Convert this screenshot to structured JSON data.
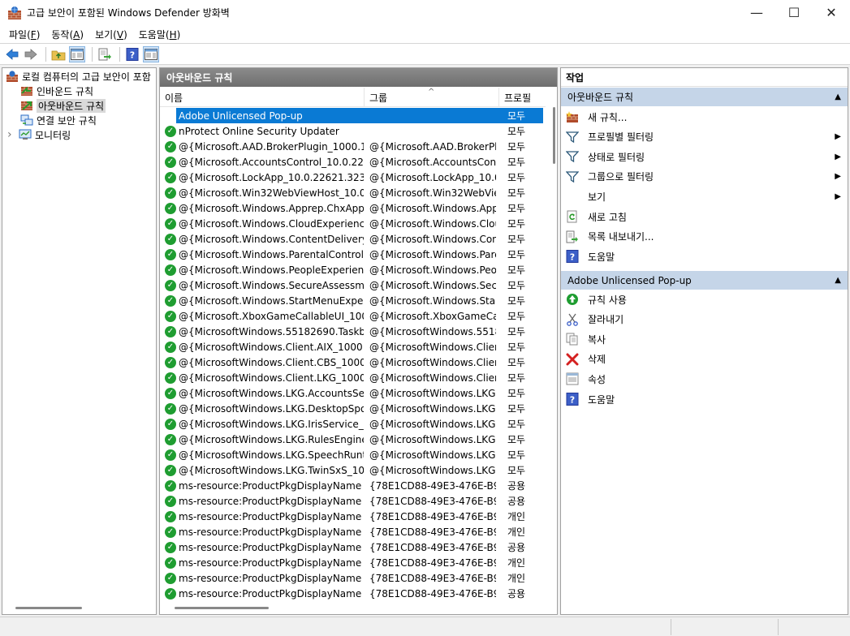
{
  "window": {
    "title": "고급 보안이 포함된 Windows Defender 방화벽",
    "minimize": "—",
    "maximize": "☐",
    "close": "✕"
  },
  "menu": [
    {
      "label": "파일",
      "key": "F"
    },
    {
      "label": "동작",
      "key": "A"
    },
    {
      "label": "보기",
      "key": "V"
    },
    {
      "label": "도움말",
      "key": "H"
    }
  ],
  "toolbar": {
    "icons": [
      "back-arrow-icon",
      "forward-arrow-icon",
      "up-folder-icon",
      "show-hide-tree-icon",
      "export-list-icon",
      "help-icon",
      "show-hide-action-pane-icon"
    ]
  },
  "tree": {
    "root": "로컬 컴퓨터의 고급 보안이 포함",
    "items": [
      "인바운드 규칙",
      "아웃바운드 규칙",
      "연결 보안 규칙",
      "모니터링"
    ],
    "expander": "›"
  },
  "center": {
    "header": "아웃바운드 규칙",
    "columns": {
      "name": "이름",
      "group": "그룹",
      "profile": "프로필"
    },
    "sort_indicator": "^",
    "rows": [
      {
        "name": "Adobe Unlicensed Pop-up",
        "group": "",
        "profile": "모두",
        "selected": true,
        "enabled": false
      },
      {
        "name": "nProtect Online Security Updater",
        "group": "",
        "profile": "모두",
        "enabled": true
      },
      {
        "name": "@{Microsoft.AAD.BrokerPlugin_1000.19...",
        "group": "@{Microsoft.AAD.BrokerPlu...",
        "profile": "모두",
        "enabled": true
      },
      {
        "name": "@{Microsoft.AccountsControl_10.0.226...",
        "group": "@{Microsoft.AccountsCont...",
        "profile": "모두",
        "enabled": true
      },
      {
        "name": "@{Microsoft.LockApp_10.0.22621.3235...",
        "group": "@{Microsoft.LockApp_10.0....",
        "profile": "모두",
        "enabled": true
      },
      {
        "name": "@{Microsoft.Win32WebViewHost_10.0....",
        "group": "@{Microsoft.Win32WebVie...",
        "profile": "모두",
        "enabled": true
      },
      {
        "name": "@{Microsoft.Windows.Apprep.ChxApp_...",
        "group": "@{Microsoft.Windows.Appr...",
        "profile": "모두",
        "enabled": true
      },
      {
        "name": "@{Microsoft.Windows.CloudExperience...",
        "group": "@{Microsoft.Windows.Clou...",
        "profile": "모두",
        "enabled": true
      },
      {
        "name": "@{Microsoft.Windows.ContentDelivery...",
        "group": "@{Microsoft.Windows.Cont...",
        "profile": "모두",
        "enabled": true
      },
      {
        "name": "@{Microsoft.Windows.ParentalControls_...",
        "group": "@{Microsoft.Windows.Pare...",
        "profile": "모두",
        "enabled": true
      },
      {
        "name": "@{Microsoft.Windows.PeopleExperience...",
        "group": "@{Microsoft.Windows.Peop...",
        "profile": "모두",
        "enabled": true
      },
      {
        "name": "@{Microsoft.Windows.SecureAssessmen...",
        "group": "@{Microsoft.Windows.Secu...",
        "profile": "모두",
        "enabled": true
      },
      {
        "name": "@{Microsoft.Windows.StartMenuExperie...",
        "group": "@{Microsoft.Windows.Start...",
        "profile": "모두",
        "enabled": true
      },
      {
        "name": "@{Microsoft.XboxGameCallableUI_1000....",
        "group": "@{Microsoft.XboxGameCall...",
        "profile": "모두",
        "enabled": true
      },
      {
        "name": "@{MicrosoftWindows.55182690.Taskba...",
        "group": "@{MicrosoftWindows.5518...",
        "profile": "모두",
        "enabled": true
      },
      {
        "name": "@{MicrosoftWindows.Client.AIX_1000.2...",
        "group": "@{MicrosoftWindows.Clien...",
        "profile": "모두",
        "enabled": true
      },
      {
        "name": "@{MicrosoftWindows.Client.CBS_1000....",
        "group": "@{MicrosoftWindows.Clien...",
        "profile": "모두",
        "enabled": true
      },
      {
        "name": "@{MicrosoftWindows.Client.LKG_1000.2...",
        "group": "@{MicrosoftWindows.Clien...",
        "profile": "모두",
        "enabled": true
      },
      {
        "name": "@{MicrosoftWindows.LKG.AccountsServ...",
        "group": "@{MicrosoftWindows.LKG....",
        "profile": "모두",
        "enabled": true
      },
      {
        "name": "@{MicrosoftWindows.LKG.DesktopSpotl...",
        "group": "@{MicrosoftWindows.LKG....",
        "profile": "모두",
        "enabled": true
      },
      {
        "name": "@{MicrosoftWindows.LKG.IrisService_10...",
        "group": "@{MicrosoftWindows.LKG.I...",
        "profile": "모두",
        "enabled": true
      },
      {
        "name": "@{MicrosoftWindows.LKG.RulesEngine_...",
        "group": "@{MicrosoftWindows.LKG....",
        "profile": "모두",
        "enabled": true
      },
      {
        "name": "@{MicrosoftWindows.LKG.SpeechRunti...",
        "group": "@{MicrosoftWindows.LKG....",
        "profile": "모두",
        "enabled": true
      },
      {
        "name": "@{MicrosoftWindows.LKG.TwinSxS_100...",
        "group": "@{MicrosoftWindows.LKG.T...",
        "profile": "모두",
        "enabled": true
      },
      {
        "name": "ms-resource:ProductPkgDisplayName",
        "group": "{78E1CD88-49E3-476E-B9...",
        "profile": "공용",
        "enabled": true
      },
      {
        "name": "ms-resource:ProductPkgDisplayName",
        "group": "{78E1CD88-49E3-476E-B9...",
        "profile": "공용",
        "enabled": true
      },
      {
        "name": "ms-resource:ProductPkgDisplayName",
        "group": "{78E1CD88-49E3-476E-B9...",
        "profile": "개인",
        "enabled": true
      },
      {
        "name": "ms-resource:ProductPkgDisplayName",
        "group": "{78E1CD88-49E3-476E-B9...",
        "profile": "개인",
        "enabled": true
      },
      {
        "name": "ms-resource:ProductPkgDisplayName",
        "group": "{78E1CD88-49E3-476E-B9...",
        "profile": "공용",
        "enabled": true
      },
      {
        "name": "ms-resource:ProductPkgDisplayName",
        "group": "{78E1CD88-49E3-476E-B9...",
        "profile": "개인",
        "enabled": true
      },
      {
        "name": "ms-resource:ProductPkgDisplayName",
        "group": "{78E1CD88-49E3-476E-B9...",
        "profile": "개인",
        "enabled": true
      },
      {
        "name": "ms-resource:ProductPkgDisplayName",
        "group": "{78E1CD88-49E3-476E-B9...",
        "profile": "공용",
        "enabled": true
      }
    ]
  },
  "actions": {
    "title": "작업",
    "section1": {
      "label": "아웃바운드 규칙",
      "items": [
        {
          "label": "새 규칙...",
          "icon": "new-rule-icon",
          "submenu": false
        },
        {
          "label": "프로필별 필터링",
          "icon": "filter-icon",
          "submenu": true
        },
        {
          "label": "상태로 필터링",
          "icon": "filter-icon",
          "submenu": true
        },
        {
          "label": "그룹으로 필터링",
          "icon": "filter-icon",
          "submenu": true
        },
        {
          "label": "보기",
          "icon": "",
          "submenu": true
        },
        {
          "label": "새로 고침",
          "icon": "refresh-icon",
          "submenu": false
        },
        {
          "label": "목록 내보내기...",
          "icon": "export-list-icon",
          "submenu": false
        },
        {
          "label": "도움말",
          "icon": "help-icon",
          "submenu": false
        }
      ]
    },
    "section2": {
      "label": "Adobe Unlicensed Pop-up",
      "items": [
        {
          "label": "규칙 사용",
          "icon": "enable-rule-icon"
        },
        {
          "label": "잘라내기",
          "icon": "cut-icon"
        },
        {
          "label": "복사",
          "icon": "copy-icon"
        },
        {
          "label": "삭제",
          "icon": "delete-icon"
        },
        {
          "label": "속성",
          "icon": "properties-icon"
        },
        {
          "label": "도움말",
          "icon": "help-icon"
        }
      ]
    },
    "collapse": "▲",
    "submenu_arrow": "▶"
  },
  "colors": {
    "selection": "#0a7ad4",
    "enabled_check": "#1f9d31",
    "section_header": "#c5d5e8",
    "pane_header": "#7d7d7d"
  }
}
